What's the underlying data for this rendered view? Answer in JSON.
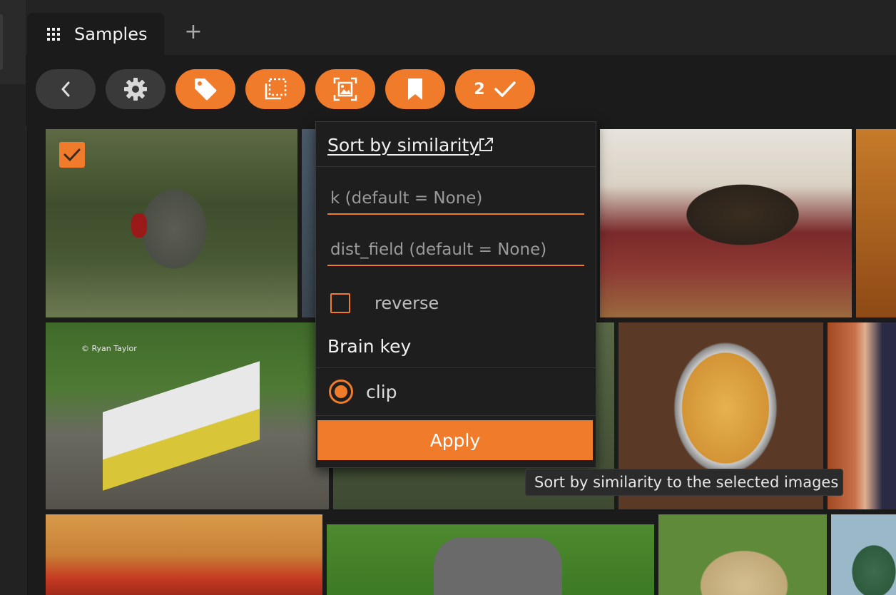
{
  "tabs": [
    {
      "label": "Samples"
    }
  ],
  "new_tab_symbol": "+",
  "toolbar": {
    "selection_count": "2",
    "icons": [
      "chevron-left-icon",
      "gear-icon",
      "tag-icon",
      "crop-select-icon",
      "image-frame-icon",
      "bookmark-icon",
      "checkmark-icon"
    ]
  },
  "grid": {
    "watermark": "© Ryan Taylor"
  },
  "popover": {
    "title": "Sort by similarity",
    "k_placeholder": "k (default = None)",
    "dist_field_placeholder": "dist_field (default = None)",
    "reverse_label": "reverse",
    "brain_key_label": "Brain key",
    "brain_key_option": "clip",
    "apply_label": "Apply"
  },
  "tooltip": "Sort by similarity to the selected images",
  "colors": {
    "accent": "#f07c2b",
    "background": "#1b1b1b",
    "pill_grey": "#3a3a3a"
  }
}
